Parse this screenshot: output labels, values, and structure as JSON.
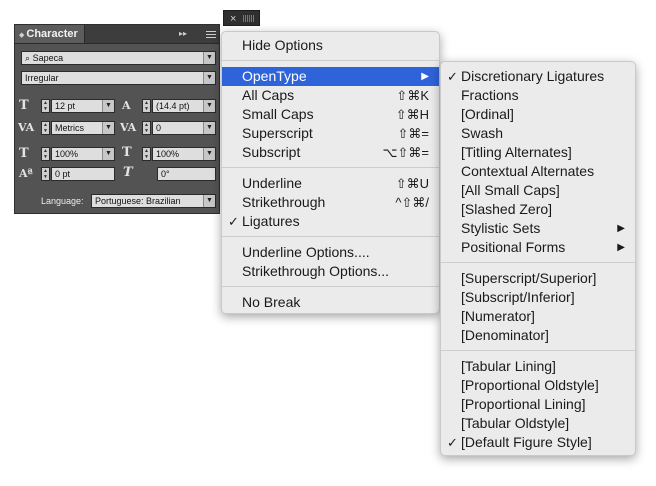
{
  "panel": {
    "title": "Character",
    "font_family": "Sapeca",
    "font_style": "Irregular",
    "font_size": "12 pt",
    "leading": "(14.4 pt)",
    "kerning": "Metrics",
    "tracking": "0",
    "vertical_scale": "100%",
    "horizontal_scale": "100%",
    "baseline_shift": "0 pt",
    "skew": "0°",
    "language_label": "Language:",
    "language_value": "Portuguese: Brazilian",
    "close_glyph": "×",
    "collapse_glyph": "▸▸"
  },
  "main_menu": {
    "items": [
      {
        "label": "Hide Options",
        "shortcut": ""
      },
      {
        "label": "OpenType",
        "shortcut": "",
        "submenu": "▶",
        "highlighted": true
      },
      {
        "label": "All Caps",
        "shortcut": "⇧⌘K"
      },
      {
        "label": "Small Caps",
        "shortcut": "⇧⌘H"
      },
      {
        "label": "Superscript",
        "shortcut": "⇧⌘="
      },
      {
        "label": "Subscript",
        "shortcut": "⌥⇧⌘="
      },
      {
        "label": "Underline",
        "shortcut": "⇧⌘U"
      },
      {
        "label": "Strikethrough",
        "shortcut": "^⇧⌘/"
      },
      {
        "label": "Ligatures",
        "shortcut": "",
        "checked": true,
        "check": "✓"
      },
      {
        "label": "Underline Options....",
        "shortcut": ""
      },
      {
        "label": "Strikethrough Options...",
        "shortcut": ""
      },
      {
        "label": "No Break",
        "shortcut": ""
      }
    ]
  },
  "opentype_menu": {
    "check": "✓",
    "submenu_arrow": "▶",
    "items": [
      {
        "label": "Discretionary Ligatures",
        "checked": true
      },
      {
        "label": "Fractions"
      },
      {
        "label": "[Ordinal]"
      },
      {
        "label": "Swash"
      },
      {
        "label": "[Titling Alternates]"
      },
      {
        "label": "Contextual Alternates"
      },
      {
        "label": "[All Small Caps]"
      },
      {
        "label": "[Slashed Zero]"
      },
      {
        "label": "Stylistic Sets",
        "submenu": true
      },
      {
        "label": "Positional Forms",
        "submenu": true
      },
      {
        "label": "[Superscript/Superior]"
      },
      {
        "label": "[Subscript/Inferior]"
      },
      {
        "label": "[Numerator]"
      },
      {
        "label": "[Denominator]"
      },
      {
        "label": "[Tabular Lining]"
      },
      {
        "label": "[Proportional Oldstyle]"
      },
      {
        "label": "[Proportional Lining]"
      },
      {
        "label": "[Tabular Oldstyle]"
      },
      {
        "label": "[Default Figure Style]",
        "checked": true
      }
    ]
  },
  "colors": {
    "highlight": "#2e63d9",
    "panel_bg": "#535353",
    "menu_bg": "#ebebeb"
  }
}
